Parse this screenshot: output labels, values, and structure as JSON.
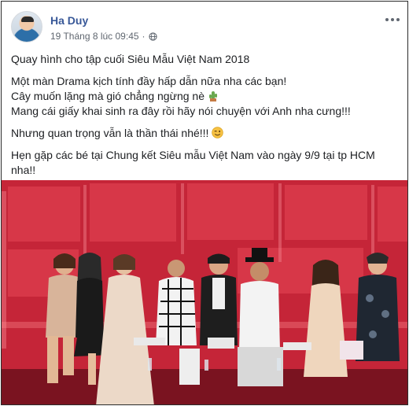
{
  "post": {
    "author": "Ha Duy",
    "timestamp": "19 Tháng 8 lúc 09:45",
    "separator": "·",
    "privacy_icon": "globe-icon",
    "more_icon": "more-options-icon",
    "paragraphs": [
      "Quay hình cho tập cuối Siêu Mẫu Việt Nam 2018",
      "Một màn Drama kịch tính đầy hấp dẫn nữa nha các bạn!",
      "Cây muốn lặng mà gió chẳng ngừng nè",
      "Mang cái giấy khai sinh ra đây rồi hãy nói chuyện với Anh nha cưng!!!",
      "Nhưng quan trọng vẫn là thần thái nhé!!!",
      "Hẹn gặp các bé tại Chung kết Siêu mẫu Việt Nam vào ngày 9/9 tại tp HCM nha!!"
    ],
    "photo_icon": "photo-judges-panel"
  },
  "colors": {
    "author": "#385898",
    "meta": "#606770",
    "text": "#1c1e21",
    "photo_bg": "#c6203a"
  }
}
